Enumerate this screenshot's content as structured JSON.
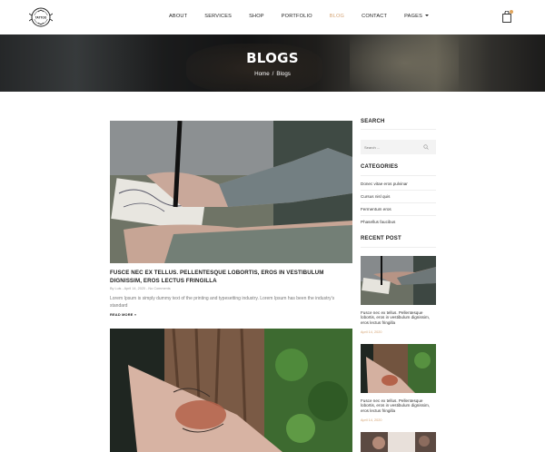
{
  "brand": {
    "logo_text": "TATTOO",
    "logo_icon": "tattoo-emblem-icon"
  },
  "nav": {
    "items": [
      {
        "label": "ABOUT"
      },
      {
        "label": "SERVICES"
      },
      {
        "label": "SHOP"
      },
      {
        "label": "PORTFOLIO"
      },
      {
        "label": "BLOG",
        "active": true
      },
      {
        "label": "CONTACT"
      },
      {
        "label": "PAGES"
      }
    ],
    "cart_icon": "shopping-bag-icon"
  },
  "banner": {
    "title": "BLOGS",
    "breadcrumb": {
      "home": "Home",
      "separator": "/",
      "current": "Blogs"
    }
  },
  "posts": [
    {
      "title": "FUSCE NEC EX TELLUS. PELLENTESQUE LOBORTIS, EROS IN VESTIBULUM DIGNISSIM, EROS LECTUS FRINGILLA",
      "meta": "By Luis - April 14, 2020 - No Comments",
      "excerpt": "Lorem Ipsum is simply dummy text of the printing and typesetting industry. Lorem Ipsum has been the industry's standard",
      "read_more": "READ MORE »"
    }
  ],
  "sidebar": {
    "search": {
      "heading": "SEARCH",
      "placeholder": "Search ..."
    },
    "categories": {
      "heading": "CATEGORIES",
      "items": [
        {
          "label": "Donec vitae eros pulvinar"
        },
        {
          "label": "Cursus nisl quis"
        },
        {
          "label": "Fermentum eros"
        },
        {
          "label": "Phasellus faucibus"
        }
      ]
    },
    "recent": {
      "heading": "RECENT POST",
      "items": [
        {
          "title": "Fusce nec ex tellus. Pellentesque lobortis, eros in vestibulum dignissim, eros lectus fringilla",
          "date": "April 14, 2020"
        },
        {
          "title": "Fusce nec ex tellus. Pellentesque lobortis, eros in vestibulum dignissim, eros lectus fringilla",
          "date": "April 14, 2020"
        }
      ]
    }
  },
  "colors": {
    "accent": "#d4a373",
    "text": "#222222",
    "muted": "#777777"
  }
}
